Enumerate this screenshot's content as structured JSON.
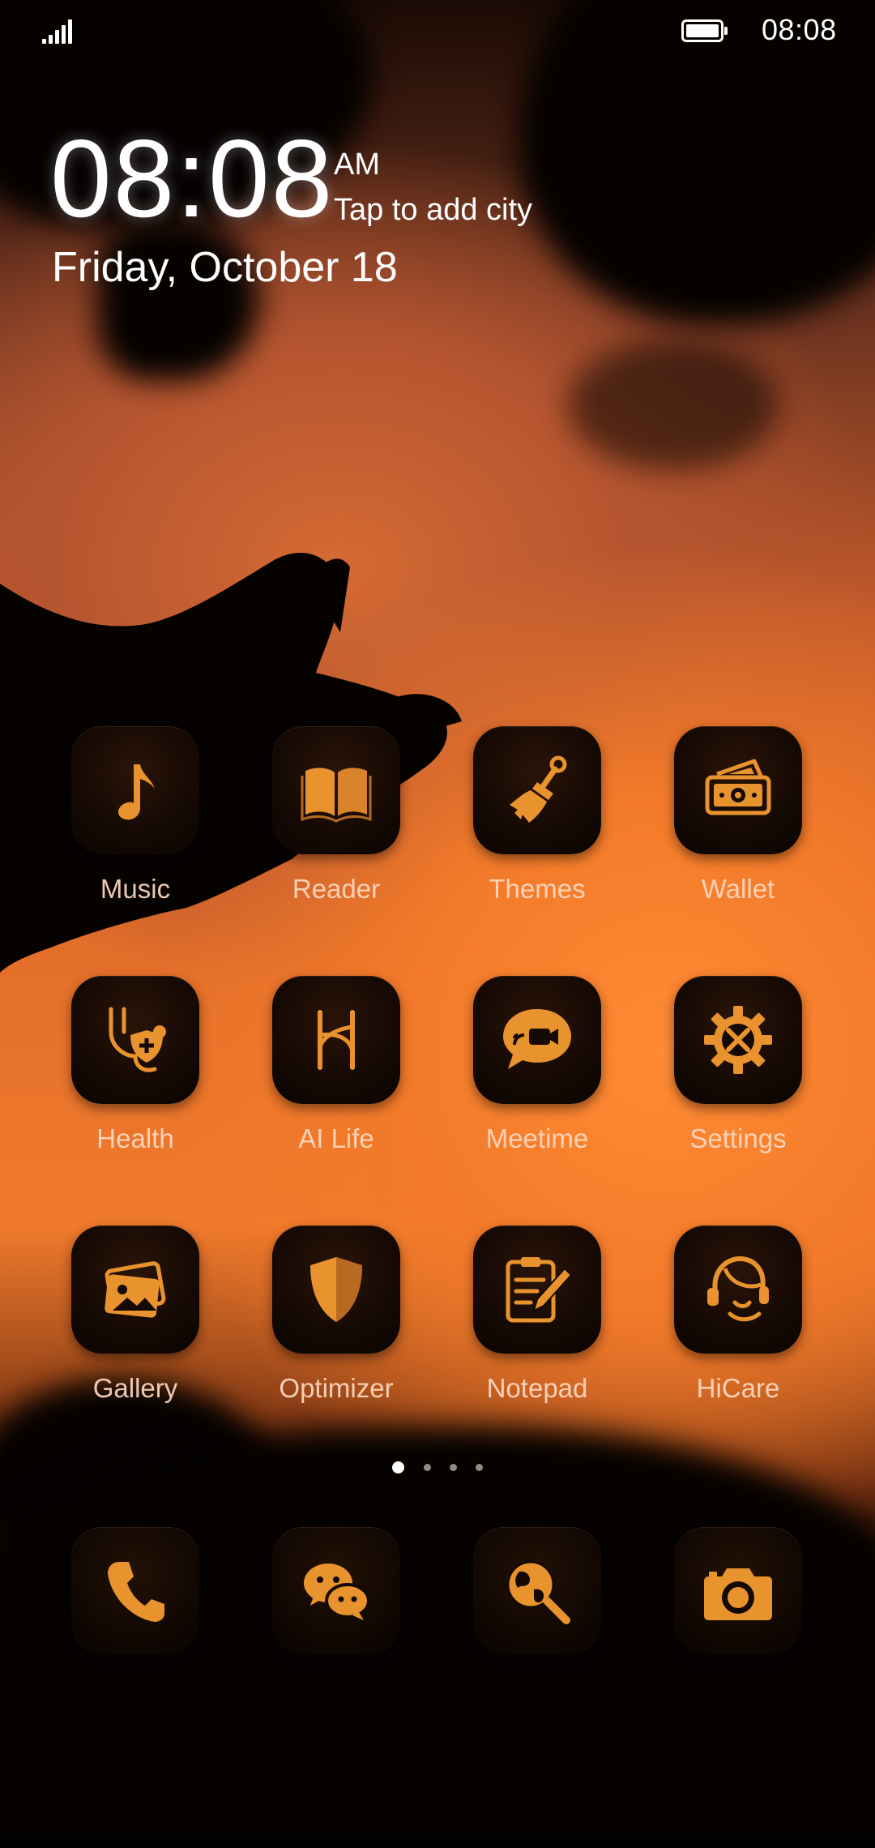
{
  "status_bar": {
    "time": "08:08",
    "battery_level": 1.0
  },
  "clock_widget": {
    "time": "08:08",
    "ampm": "AM",
    "city_prompt": "Tap to add city",
    "date": "Friday, October 18"
  },
  "apps": [
    {
      "label": "Music",
      "icon": "music-note-icon"
    },
    {
      "label": "Reader",
      "icon": "book-icon"
    },
    {
      "label": "Themes",
      "icon": "paint-brush-icon"
    },
    {
      "label": "Wallet",
      "icon": "wallet-icon"
    },
    {
      "label": "Health",
      "icon": "health-icon"
    },
    {
      "label": "AI Life",
      "icon": "ai-life-icon"
    },
    {
      "label": "Meetime",
      "icon": "video-chat-icon"
    },
    {
      "label": "Settings",
      "icon": "gear-icon"
    },
    {
      "label": "Gallery",
      "icon": "gallery-icon"
    },
    {
      "label": "Optimizer",
      "icon": "shield-icon"
    },
    {
      "label": "Notepad",
      "icon": "notepad-icon"
    },
    {
      "label": "HiCare",
      "icon": "support-headset-icon"
    }
  ],
  "page_indicator": {
    "pages": 4,
    "current": 1
  },
  "dock": [
    {
      "icon": "phone-icon"
    },
    {
      "icon": "chat-bubbles-icon"
    },
    {
      "icon": "globe-search-icon"
    },
    {
      "icon": "camera-icon"
    }
  ],
  "colors": {
    "icon_accent": "#e8932d",
    "tile_bg": "#150904",
    "label": "#ffd9c2"
  }
}
